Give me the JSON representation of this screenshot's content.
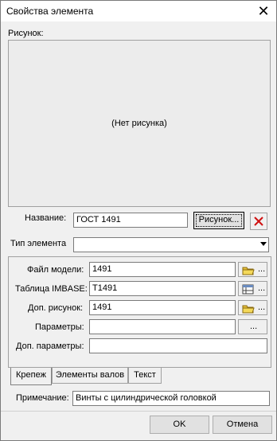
{
  "window": {
    "title": "Свойства элемента"
  },
  "preview": {
    "label": "Рисунок:",
    "empty_text": "(Нет рисунка)"
  },
  "name_row": {
    "label": "Название:",
    "value": "ГОСТ 1491",
    "picture_button": "Рисунок..."
  },
  "type_row": {
    "label": "Тип элемента",
    "value": ""
  },
  "fields": [
    {
      "label": "Файл модели:",
      "value": "1491",
      "icon": "folder-icon",
      "more": "..."
    },
    {
      "label": "Таблица IMBASE:",
      "value": "T1491",
      "icon": "table-icon",
      "more": "..."
    },
    {
      "label": "Доп. рисунок:",
      "value": "1491",
      "icon": "folder-icon",
      "more": "..."
    },
    {
      "label": "Параметры:",
      "value": "",
      "more": "..."
    },
    {
      "label": "Доп. параметры:",
      "value": ""
    }
  ],
  "tabs": [
    {
      "label": "Крепеж",
      "active": true
    },
    {
      "label": "Элементы валов",
      "active": false
    },
    {
      "label": "Текст",
      "active": false
    }
  ],
  "note_row": {
    "label": "Примечание:",
    "value": "Винты с цилиндрической головкой"
  },
  "buttons": {
    "ok": "OK",
    "cancel": "Отмена"
  },
  "colors": {
    "delete": "#d01010",
    "folder": "#e8c23a"
  }
}
